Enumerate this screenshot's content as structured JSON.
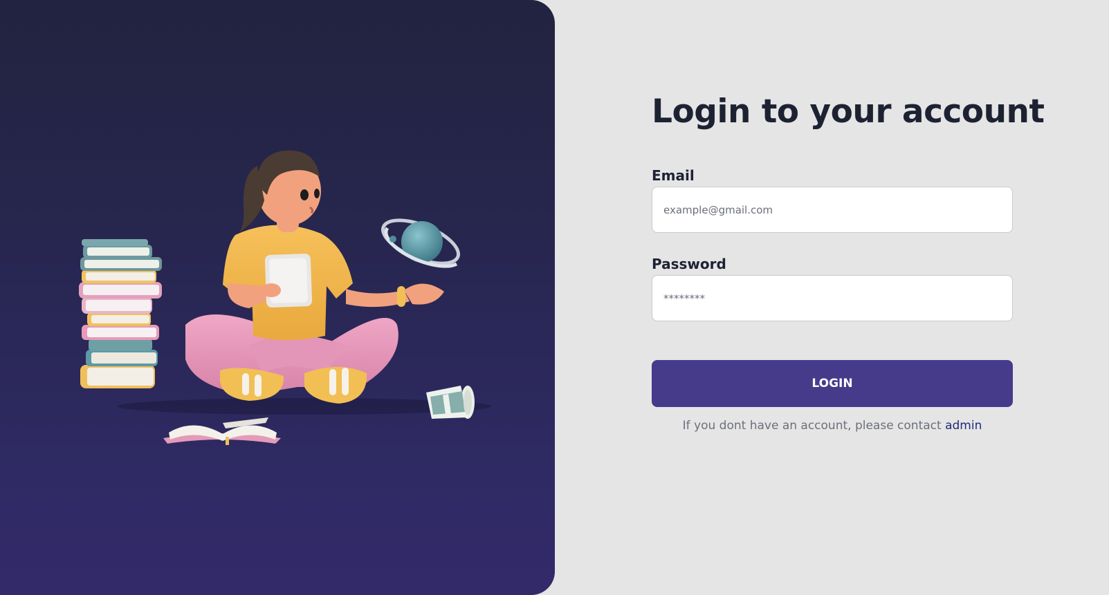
{
  "login": {
    "title": "Login to your account",
    "email_label": "Email",
    "email_placeholder": "example@gmail.com",
    "password_label": "Password",
    "password_placeholder": "********",
    "button_label": "LOGIN",
    "footer_text": "If you dont have an account, please contact",
    "footer_link": "admin"
  },
  "theme": {
    "panel_top": "#22233f",
    "panel_bottom": "#332a6a",
    "button": "#463b8b",
    "link": "#1f2a78",
    "title": "#1d2233",
    "background": "#e5e5e5"
  },
  "illustration": {
    "icon": "student-reading-illustration"
  }
}
